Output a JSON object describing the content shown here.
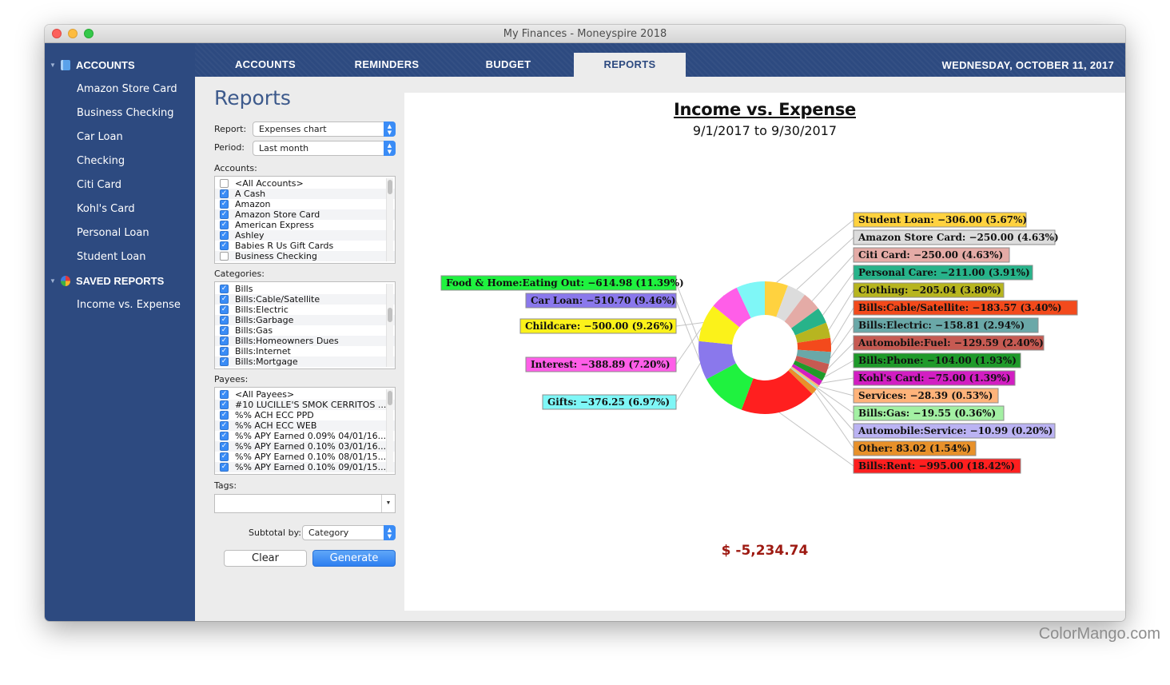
{
  "window": {
    "title": "My Finances - Moneyspire 2018"
  },
  "sidebar": {
    "accounts_header": "ACCOUNTS",
    "accounts": [
      "Amazon Store Card",
      "Business Checking",
      "Car Loan",
      "Checking",
      "Citi Card",
      "Kohl's Card",
      "Personal Loan",
      "Student Loan"
    ],
    "saved_header": "SAVED REPORTS",
    "saved": [
      "Income vs. Expense"
    ]
  },
  "tabs": [
    {
      "label": "ACCOUNTS"
    },
    {
      "label": "REMINDERS"
    },
    {
      "label": "BUDGET"
    },
    {
      "label": "REPORTS"
    }
  ],
  "active_tab": "REPORTS",
  "date": "WEDNESDAY, OCTOBER 11, 2017",
  "panel": {
    "title": "Reports",
    "report_label": "Report:",
    "report_value": "Expenses chart",
    "period_label": "Period:",
    "period_value": "Last month",
    "accounts_label": "Accounts:",
    "accounts_list": [
      {
        "name": "<All Accounts>",
        "checked": false
      },
      {
        "name": "A Cash",
        "checked": true
      },
      {
        "name": "Amazon",
        "checked": true
      },
      {
        "name": "Amazon Store Card",
        "checked": true
      },
      {
        "name": "American Express",
        "checked": true
      },
      {
        "name": "Ashley",
        "checked": true
      },
      {
        "name": "Babies R Us Gift Cards",
        "checked": true
      },
      {
        "name": "Business Checking",
        "checked": false
      }
    ],
    "categories_label": "Categories:",
    "categories_list": [
      {
        "name": "Bills",
        "checked": true
      },
      {
        "name": "Bills:Cable/Satellite",
        "checked": true
      },
      {
        "name": "Bills:Electric",
        "checked": true
      },
      {
        "name": "Bills:Garbage",
        "checked": true
      },
      {
        "name": "Bills:Gas",
        "checked": true
      },
      {
        "name": "Bills:Homeowners Dues",
        "checked": true
      },
      {
        "name": "Bills:Internet",
        "checked": true
      },
      {
        "name": "Bills:Mortgage",
        "checked": true
      }
    ],
    "payees_label": "Payees:",
    "payees_list": [
      {
        "name": "<All Payees>",
        "checked": true
      },
      {
        "name": "#10 LUCILLE'S SMOK CERRITOS ...",
        "checked": true
      },
      {
        "name": "%% ACH ECC PPD",
        "checked": true
      },
      {
        "name": "%% ACH ECC WEB",
        "checked": true
      },
      {
        "name": "%% APY Earned 0.09% 04/01/16...",
        "checked": true
      },
      {
        "name": "%% APY Earned 0.10% 03/01/16...",
        "checked": true
      },
      {
        "name": "%% APY Earned 0.10% 08/01/15...",
        "checked": true
      },
      {
        "name": "%% APY Earned 0.10% 09/01/15...",
        "checked": true
      }
    ],
    "tags_label": "Tags:",
    "subtotal_label": "Subtotal by:",
    "subtotal_value": "Category",
    "clear_label": "Clear",
    "generate_label": "Generate"
  },
  "report": {
    "title": "Income vs. Expense",
    "subtitle": "9/1/2017 to 9/30/2017",
    "total": "$ -5,234.74"
  },
  "chart_data": {
    "type": "pie",
    "title": "Income vs. Expense",
    "subtitle": "9/1/2017 to 9/30/2017",
    "slices": [
      {
        "label": "Student Loan",
        "value": -306.0,
        "percent": 5.67,
        "color": "#ffd23f"
      },
      {
        "label": "Amazon Store Card",
        "value": -250.0,
        "percent": 4.63,
        "color": "#dcdcdc"
      },
      {
        "label": "Citi Card",
        "value": -250.0,
        "percent": 4.63,
        "color": "#e4aba6"
      },
      {
        "label": "Personal Care",
        "value": -211.0,
        "percent": 3.91,
        "color": "#27b38a"
      },
      {
        "label": "Clothing",
        "value": -205.04,
        "percent": 3.8,
        "color": "#b7b520"
      },
      {
        "label": "Bills:Cable/Satellite",
        "value": -183.57,
        "percent": 3.4,
        "color": "#f34a1c"
      },
      {
        "label": "Bills:Electric",
        "value": -158.81,
        "percent": 2.94,
        "color": "#6aa8a8"
      },
      {
        "label": "Automobile:Fuel",
        "value": -129.59,
        "percent": 2.4,
        "color": "#c65a52"
      },
      {
        "label": "Bills:Phone",
        "value": -104.0,
        "percent": 1.93,
        "color": "#1f9a2a"
      },
      {
        "label": "Kohl's Card",
        "value": -75.0,
        "percent": 1.39,
        "color": "#d21ec2"
      },
      {
        "label": "Services",
        "value": -28.39,
        "percent": 0.53,
        "color": "#ffb37a"
      },
      {
        "label": "Bills:Gas",
        "value": -19.55,
        "percent": 0.36,
        "color": "#a3f0a3"
      },
      {
        "label": "Automobile:Service",
        "value": -10.99,
        "percent": 0.2,
        "color": "#bbb3f3"
      },
      {
        "label": "Other",
        "value": 83.02,
        "percent": 1.54,
        "color": "#e8912a"
      },
      {
        "label": "Bills:Rent",
        "value": -995.0,
        "percent": 18.42,
        "color": "#ff1f1f"
      },
      {
        "label": "Food & Home:Eating Out",
        "value": -614.98,
        "percent": 11.39,
        "color": "#1ff23f"
      },
      {
        "label": "Car Loan",
        "value": -510.7,
        "percent": 9.46,
        "color": "#8a78ec"
      },
      {
        "label": "Childcare",
        "value": -500.0,
        "percent": 9.26,
        "color": "#fbf21a"
      },
      {
        "label": "Interest",
        "value": -388.89,
        "percent": 7.2,
        "color": "#ff5ee8"
      },
      {
        "label": "Gifts",
        "value": -376.25,
        "percent": 6.97,
        "color": "#7ff7f7"
      }
    ],
    "total": "$ -5,234.74"
  }
}
